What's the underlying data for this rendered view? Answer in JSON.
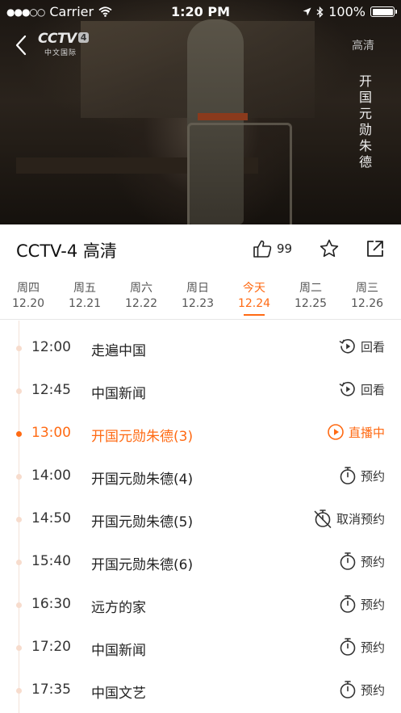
{
  "status_bar": {
    "carrier": "Carrier",
    "time": "1:20 PM",
    "battery": "100%"
  },
  "player": {
    "logo_brand": "CCTV",
    "logo_number": "4",
    "logo_sub": "中文国际",
    "quality": "高清",
    "overlay_title": "开国元勋朱德"
  },
  "channel": {
    "title": "CCTV-4 高清",
    "like_count": "99"
  },
  "date_tabs": [
    {
      "weekday": "周四",
      "date": "12.20"
    },
    {
      "weekday": "周五",
      "date": "12.21"
    },
    {
      "weekday": "周六",
      "date": "12.22"
    },
    {
      "weekday": "周日",
      "date": "12.23"
    },
    {
      "weekday": "今天",
      "date": "12.24"
    },
    {
      "weekday": "周二",
      "date": "12.25"
    },
    {
      "weekday": "周三",
      "date": "12.26"
    }
  ],
  "active_tab_index": 4,
  "programs": [
    {
      "time": "12:00",
      "name": "走遍中国",
      "action": "回看",
      "action_icon": "replay-icon",
      "state": "past"
    },
    {
      "time": "12:45",
      "name": "中国新闻",
      "action": "回看",
      "action_icon": "replay-icon",
      "state": "past"
    },
    {
      "time": "13:00",
      "name": "开国元勋朱德(3)",
      "action": "直播中",
      "action_icon": "play-circle-icon",
      "state": "live"
    },
    {
      "time": "14:00",
      "name": "开国元勋朱德(4)",
      "action": "预约",
      "action_icon": "stopwatch-icon",
      "state": "future"
    },
    {
      "time": "14:50",
      "name": "开国元勋朱德(5)",
      "action": "取消预约",
      "action_icon": "stopwatch-cancel-icon",
      "state": "future"
    },
    {
      "time": "15:40",
      "name": "开国元勋朱德(6)",
      "action": "预约",
      "action_icon": "stopwatch-icon",
      "state": "future"
    },
    {
      "time": "16:30",
      "name": "远方的家",
      "action": "预约",
      "action_icon": "stopwatch-icon",
      "state": "future"
    },
    {
      "time": "17:20",
      "name": "中国新闻",
      "action": "预约",
      "action_icon": "stopwatch-icon",
      "state": "future"
    },
    {
      "time": "17:35",
      "name": "中国文艺",
      "action": "预约",
      "action_icon": "stopwatch-icon",
      "state": "future"
    }
  ],
  "colors": {
    "accent": "#ff6a13",
    "timeline": "#f3e2d8",
    "text": "#222222"
  }
}
